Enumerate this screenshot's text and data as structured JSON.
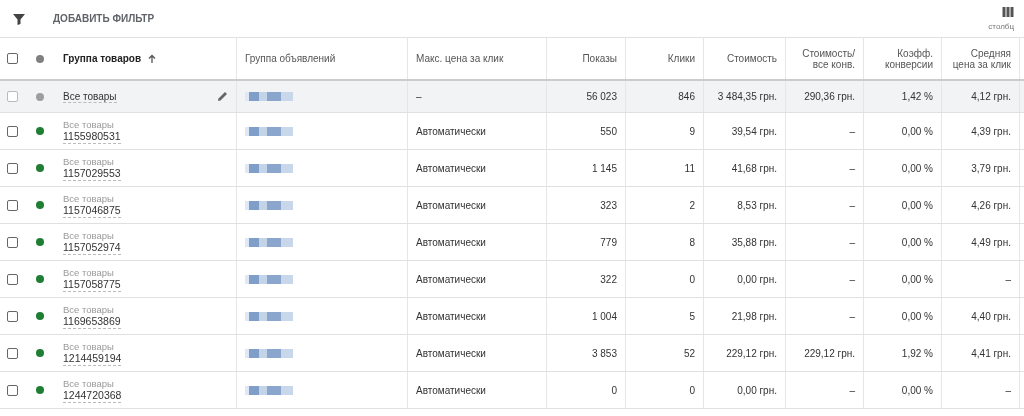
{
  "toolbar": {
    "add_filter": "ДОБАВИТЬ ФИЛЬТР",
    "columns_button": "столбц"
  },
  "table": {
    "columns": [
      {
        "label": "Группа товаров",
        "sorted": true
      },
      {
        "label": "Группа объявлений",
        "sorted": false
      },
      {
        "label": "Макс. цена за клик",
        "sorted": false
      },
      {
        "label": "Показы",
        "sorted": false
      },
      {
        "label": "Клики",
        "sorted": false
      },
      {
        "label": "Стоимость",
        "sorted": false
      },
      {
        "label": "Стоимость/все конв.",
        "sorted": false
      },
      {
        "label": "Коэфф. конверсии",
        "sorted": false
      },
      {
        "label": "Средняя цена за клик",
        "sorted": false
      }
    ],
    "select_all_checked": false,
    "rows": [
      {
        "kind": "summary",
        "checked": false,
        "color": "#9e9e9e",
        "group": "Все товары",
        "max_cpc": "–",
        "impressions": "56 023",
        "clicks": "846",
        "cost": "3 484,35 грн.",
        "cost_per_conv": "290,36 грн.",
        "conv_rate": "1,42 %",
        "avg_cpc": "4,12 грн."
      },
      {
        "kind": "item",
        "checked": false,
        "color": "#1e7e34",
        "group": "Все товары",
        "id": "1155980531",
        "max_cpc": "Автоматически",
        "impressions": "550",
        "clicks": "9",
        "cost": "39,54 грн.",
        "cost_per_conv": "–",
        "conv_rate": "0,00 %",
        "avg_cpc": "4,39 грн."
      },
      {
        "kind": "item",
        "checked": false,
        "color": "#1e7e34",
        "group": "Все товары",
        "id": "1157029553",
        "max_cpc": "Автоматически",
        "impressions": "1 145",
        "clicks": "11",
        "cost": "41,68 грн.",
        "cost_per_conv": "–",
        "conv_rate": "0,00 %",
        "avg_cpc": "3,79 грн."
      },
      {
        "kind": "item",
        "checked": false,
        "color": "#1e7e34",
        "group": "Все товары",
        "id": "1157046875",
        "max_cpc": "Автоматически",
        "impressions": "323",
        "clicks": "2",
        "cost": "8,53 грн.",
        "cost_per_conv": "–",
        "conv_rate": "0,00 %",
        "avg_cpc": "4,26 грн."
      },
      {
        "kind": "item",
        "checked": false,
        "color": "#1e7e34",
        "group": "Все товары",
        "id": "1157052974",
        "max_cpc": "Автоматически",
        "impressions": "779",
        "clicks": "8",
        "cost": "35,88 грн.",
        "cost_per_conv": "–",
        "conv_rate": "0,00 %",
        "avg_cpc": "4,49 грн."
      },
      {
        "kind": "item",
        "checked": false,
        "color": "#1e7e34",
        "group": "Все товары",
        "id": "1157058775",
        "max_cpc": "Автоматически",
        "impressions": "322",
        "clicks": "0",
        "cost": "0,00 грн.",
        "cost_per_conv": "–",
        "conv_rate": "0,00 %",
        "avg_cpc": "–"
      },
      {
        "kind": "item",
        "checked": false,
        "color": "#1e7e34",
        "group": "Все товары",
        "id": "1169653869",
        "max_cpc": "Автоматически",
        "impressions": "1 004",
        "clicks": "5",
        "cost": "21,98 грн.",
        "cost_per_conv": "–",
        "conv_rate": "0,00 %",
        "avg_cpc": "4,40 грн."
      },
      {
        "kind": "item",
        "checked": false,
        "color": "#1e7e34",
        "group": "Все товары",
        "id": "1214459194",
        "max_cpc": "Автоматически",
        "impressions": "3 853",
        "clicks": "52",
        "cost": "229,12 грн.",
        "cost_per_conv": "229,12 грн.",
        "conv_rate": "1,92 %",
        "avg_cpc": "4,41 грн."
      },
      {
        "kind": "item",
        "checked": false,
        "color": "#1e7e34",
        "group": "Все товары",
        "id": "1244720368",
        "max_cpc": "Автоматически",
        "impressions": "0",
        "clicks": "0",
        "cost": "0,00 грн.",
        "cost_per_conv": "–",
        "conv_rate": "0,00 %",
        "avg_cpc": "–"
      }
    ]
  }
}
